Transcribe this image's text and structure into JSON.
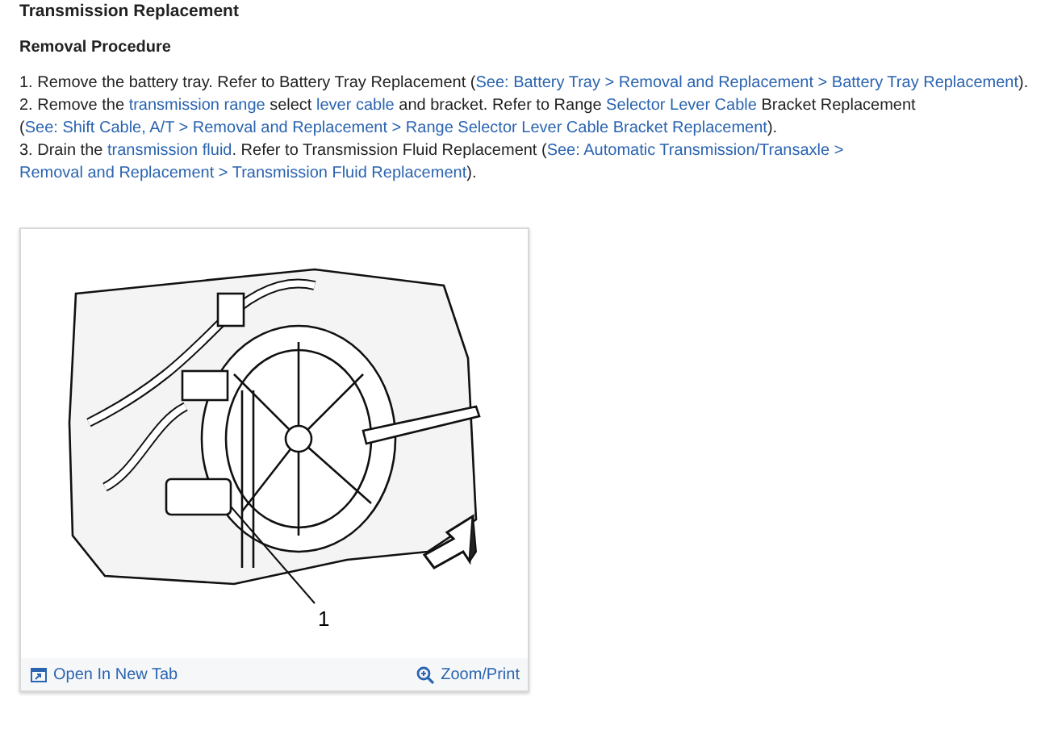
{
  "page_title": "Transmission Replacement",
  "section_title": "Removal Procedure",
  "steps": [
    {
      "number": "1.",
      "parts": [
        {
          "kind": "text",
          "text": "Remove the battery tray. Refer to Battery Tray Replacement ("
        },
        {
          "kind": "link",
          "text": "See: Battery Tray >"
        },
        {
          "kind": "gap"
        },
        {
          "kind": "link",
          "text": "Removal and Replacement >"
        },
        {
          "kind": "gap"
        },
        {
          "kind": "link",
          "text": "Battery Tray Replacement"
        },
        {
          "kind": "text",
          "text": ")."
        }
      ]
    },
    {
      "number": "2.",
      "parts": [
        {
          "kind": "text",
          "text": "Remove the "
        },
        {
          "kind": "link",
          "text": "transmission range"
        },
        {
          "kind": "text",
          "text": " select "
        },
        {
          "kind": "link",
          "text": "lever cable"
        },
        {
          "kind": "text",
          "text": " and bracket. Refer to Range "
        },
        {
          "kind": "link",
          "text": "Selector Lever Cable"
        },
        {
          "kind": "text",
          "text": " Bracket Replacement ("
        },
        {
          "kind": "link",
          "text": "See: Shift Cable, A/T >"
        },
        {
          "kind": "gap"
        },
        {
          "kind": "link",
          "text": "Removal and Replacement >"
        },
        {
          "kind": "gap"
        },
        {
          "kind": "link",
          "text": "Range Selector Lever Cable Bracket Replacement"
        },
        {
          "kind": "text",
          "text": ")."
        }
      ]
    },
    {
      "number": "3.",
      "parts": [
        {
          "kind": "text",
          "text": "Drain the "
        },
        {
          "kind": "link",
          "text": "transmission fluid"
        },
        {
          "kind": "text",
          "text": ". Refer to Transmission Fluid Replacement ("
        },
        {
          "kind": "link",
          "text": "See: Automatic Transmission/Transaxle >"
        },
        {
          "kind": "gap"
        },
        {
          "kind": "link",
          "text": "Removal and Replacement >"
        },
        {
          "kind": "gap"
        },
        {
          "kind": "link",
          "text": "Transmission Fluid Replacement"
        },
        {
          "kind": "text",
          "text": ")."
        }
      ]
    }
  ],
  "figure": {
    "callout": "1",
    "open_link": "Open In New Tab",
    "zoom_link": "Zoom/Print"
  }
}
